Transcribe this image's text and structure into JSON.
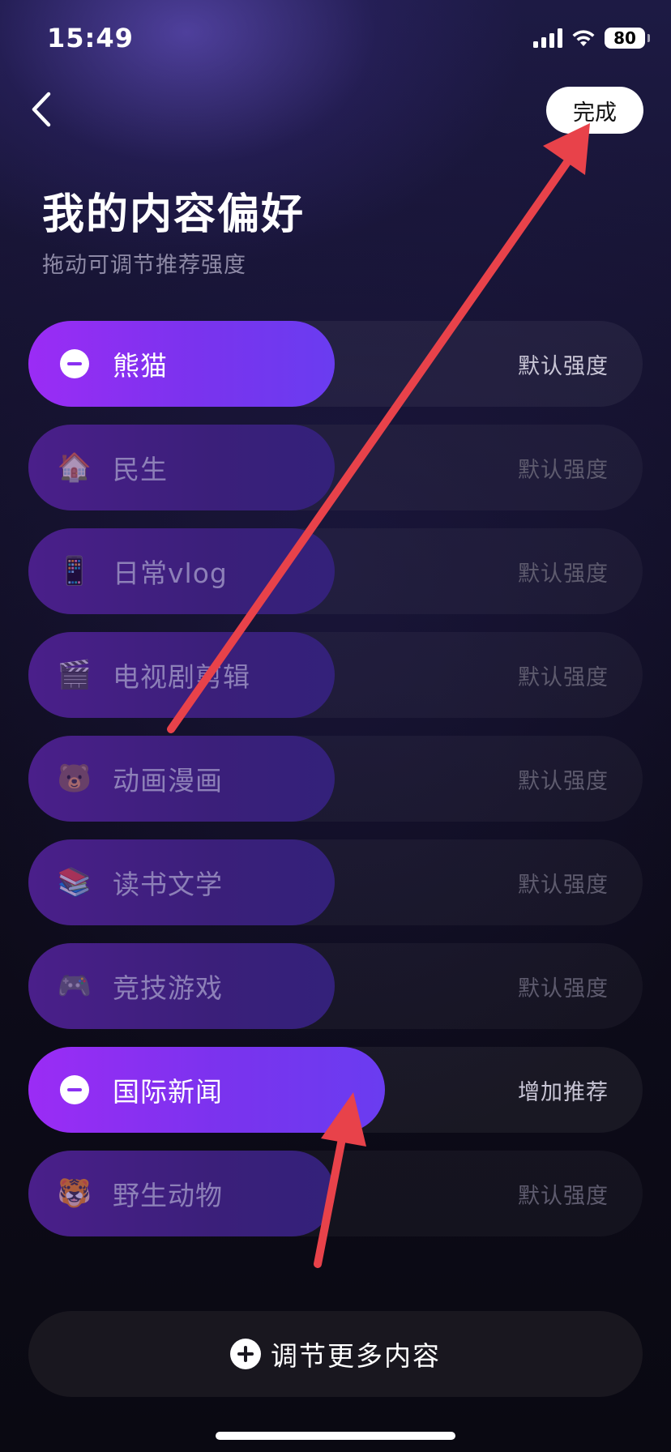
{
  "status_bar": {
    "time": "15:49",
    "battery": "80"
  },
  "header": {
    "done_label": "完成"
  },
  "title": "我的内容偏好",
  "subtitle": "拖动可调节推荐强度",
  "preferences": [
    {
      "label": "熊猫",
      "strength": "默认强度",
      "icon": "minus-circle-icon",
      "active": true
    },
    {
      "label": "民生",
      "strength": "默认强度",
      "icon": "🏠",
      "active": false
    },
    {
      "label": "日常vlog",
      "strength": "默认强度",
      "icon": "📱",
      "active": false
    },
    {
      "label": "电视剧剪辑",
      "strength": "默认强度",
      "icon": "🎬",
      "active": false
    },
    {
      "label": "动画漫画",
      "strength": "默认强度",
      "icon": "🐻",
      "active": false
    },
    {
      "label": "读书文学",
      "strength": "默认强度",
      "icon": "📚",
      "active": false
    },
    {
      "label": "竞技游戏",
      "strength": "默认强度",
      "icon": "🎮",
      "active": false
    },
    {
      "label": "国际新闻",
      "strength": "增加推荐",
      "icon": "minus-circle-icon",
      "active": true
    },
    {
      "label": "野生动物",
      "strength": "默认强度",
      "icon": "🐯",
      "active": false
    }
  ],
  "more_button": {
    "label": "调节更多内容"
  },
  "colors": {
    "accent_start": "#9b2cf5",
    "accent_end": "#6a3cf0",
    "annotation_arrow": "#e8424a"
  }
}
